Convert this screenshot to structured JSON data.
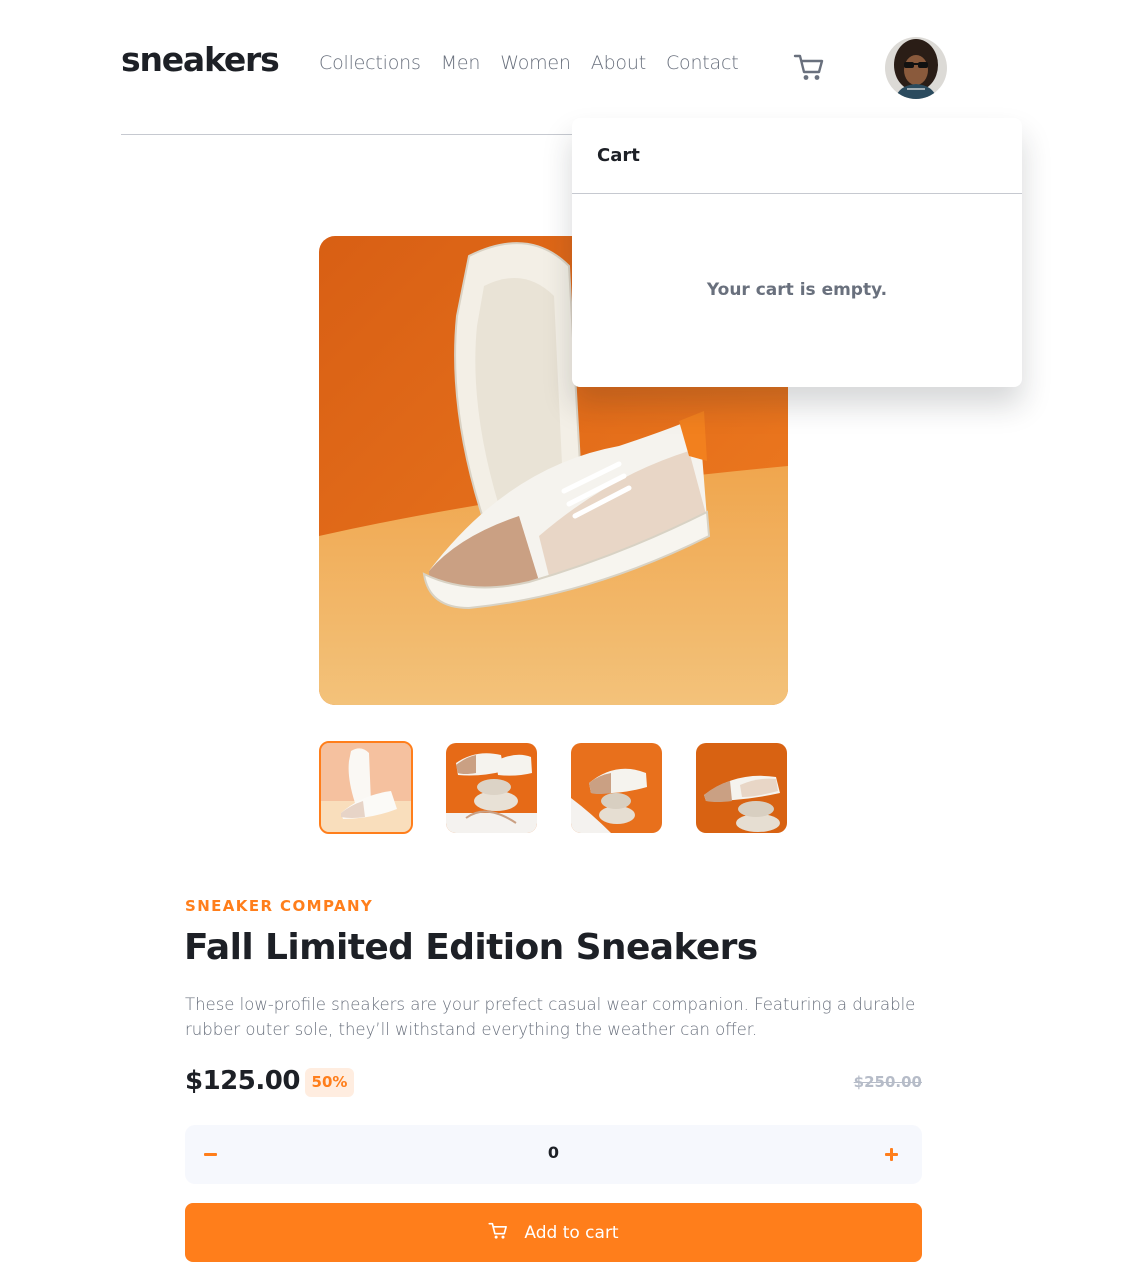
{
  "header": {
    "logo": "sneakers",
    "nav": [
      "Collections",
      "Men",
      "Women",
      "About",
      "Contact"
    ],
    "cart_icon": "cart-icon",
    "avatar_icon": "avatar"
  },
  "cart": {
    "title": "Cart",
    "empty_message": "Your cart is empty."
  },
  "product": {
    "company": "SNEAKER COMPANY",
    "title": "Fall Limited Edition Sneakers",
    "description": "These low-profile sneakers are your prefect casual wear companion. Featuring a durable rubber outer sole, they’ll withstand everything the weather can offer.",
    "price": "$125.00",
    "discount": "50%",
    "original_price": "$250.00",
    "quantity": "0",
    "add_to_cart": "Add to cart",
    "thumbnails": [
      "thumbnail-1",
      "thumbnail-2",
      "thumbnail-3",
      "thumbnail-4"
    ],
    "active_thumbnail": 1
  },
  "colors": {
    "accent": "#ff7e1b",
    "accent_pale": "#ffede0",
    "text_dark": "#1d2026",
    "text_muted": "#69707d",
    "text_light": "#b6bcc8",
    "qty_bg": "#f6f8fd"
  }
}
